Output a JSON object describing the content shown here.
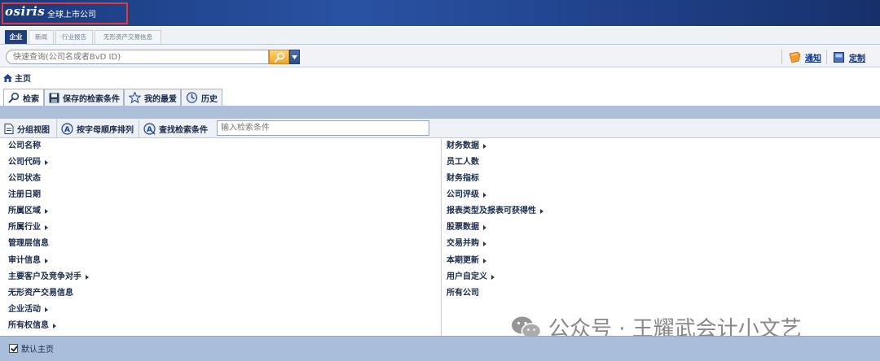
{
  "header": {
    "logo": "osiris",
    "subtitle": "全球上市公司"
  },
  "top_tabs": [
    {
      "label": "企业",
      "active": true
    },
    {
      "label": "新闻",
      "active": false
    },
    {
      "label": "行业报告",
      "active": false
    },
    {
      "label": "无形资产交易信息",
      "active": false
    }
  ],
  "search": {
    "placeholder": "快速查询(公司名或者BvD ID)"
  },
  "toolbar": {
    "notify": "通知",
    "customize": "定制"
  },
  "breadcrumb": {
    "home": "主页"
  },
  "main_tabs": [
    {
      "label": "检索",
      "icon": "search-icon",
      "active": true
    },
    {
      "label": "保存的检索条件",
      "icon": "save-icon",
      "active": false
    },
    {
      "label": "我的最爱",
      "icon": "star-icon",
      "active": false
    },
    {
      "label": "历史",
      "icon": "history-icon",
      "active": false
    }
  ],
  "tools": {
    "group_view": "分组视图",
    "alpha_sort": "按字母顺序排列",
    "find_criteria": "查找检索条件",
    "filter_placeholder": "输入检索条件"
  },
  "left_items": [
    {
      "label": "公司名称",
      "arrow": false
    },
    {
      "label": "公司代码",
      "arrow": true
    },
    {
      "label": "公司状态",
      "arrow": false
    },
    {
      "label": "注册日期",
      "arrow": false
    },
    {
      "label": "所属区域",
      "arrow": true
    },
    {
      "label": "所属行业",
      "arrow": true
    },
    {
      "label": "管理层信息",
      "arrow": false
    },
    {
      "label": "审计信息",
      "arrow": true
    },
    {
      "label": "主要客户及竞争对手",
      "arrow": true
    },
    {
      "label": "无形资产交易信息",
      "arrow": false
    },
    {
      "label": "企业活动",
      "arrow": true
    },
    {
      "label": "所有权信息",
      "arrow": true
    }
  ],
  "right_items": [
    {
      "label": "财务数据",
      "arrow": true
    },
    {
      "label": "员工人数",
      "arrow": false
    },
    {
      "label": "财务指标",
      "arrow": false
    },
    {
      "label": "公司评级",
      "arrow": true
    },
    {
      "label": "报表类型及报表可获得性",
      "arrow": true
    },
    {
      "label": "股票数据",
      "arrow": true
    },
    {
      "label": "交易并购",
      "arrow": true
    },
    {
      "label": "本期更新",
      "arrow": true
    },
    {
      "label": "用户自定义",
      "arrow": true
    },
    {
      "label": "所有公司",
      "arrow": false
    }
  ],
  "watermark": "公众号 · 王耀武会计小文艺",
  "footer": {
    "default_home": "默认主页"
  }
}
